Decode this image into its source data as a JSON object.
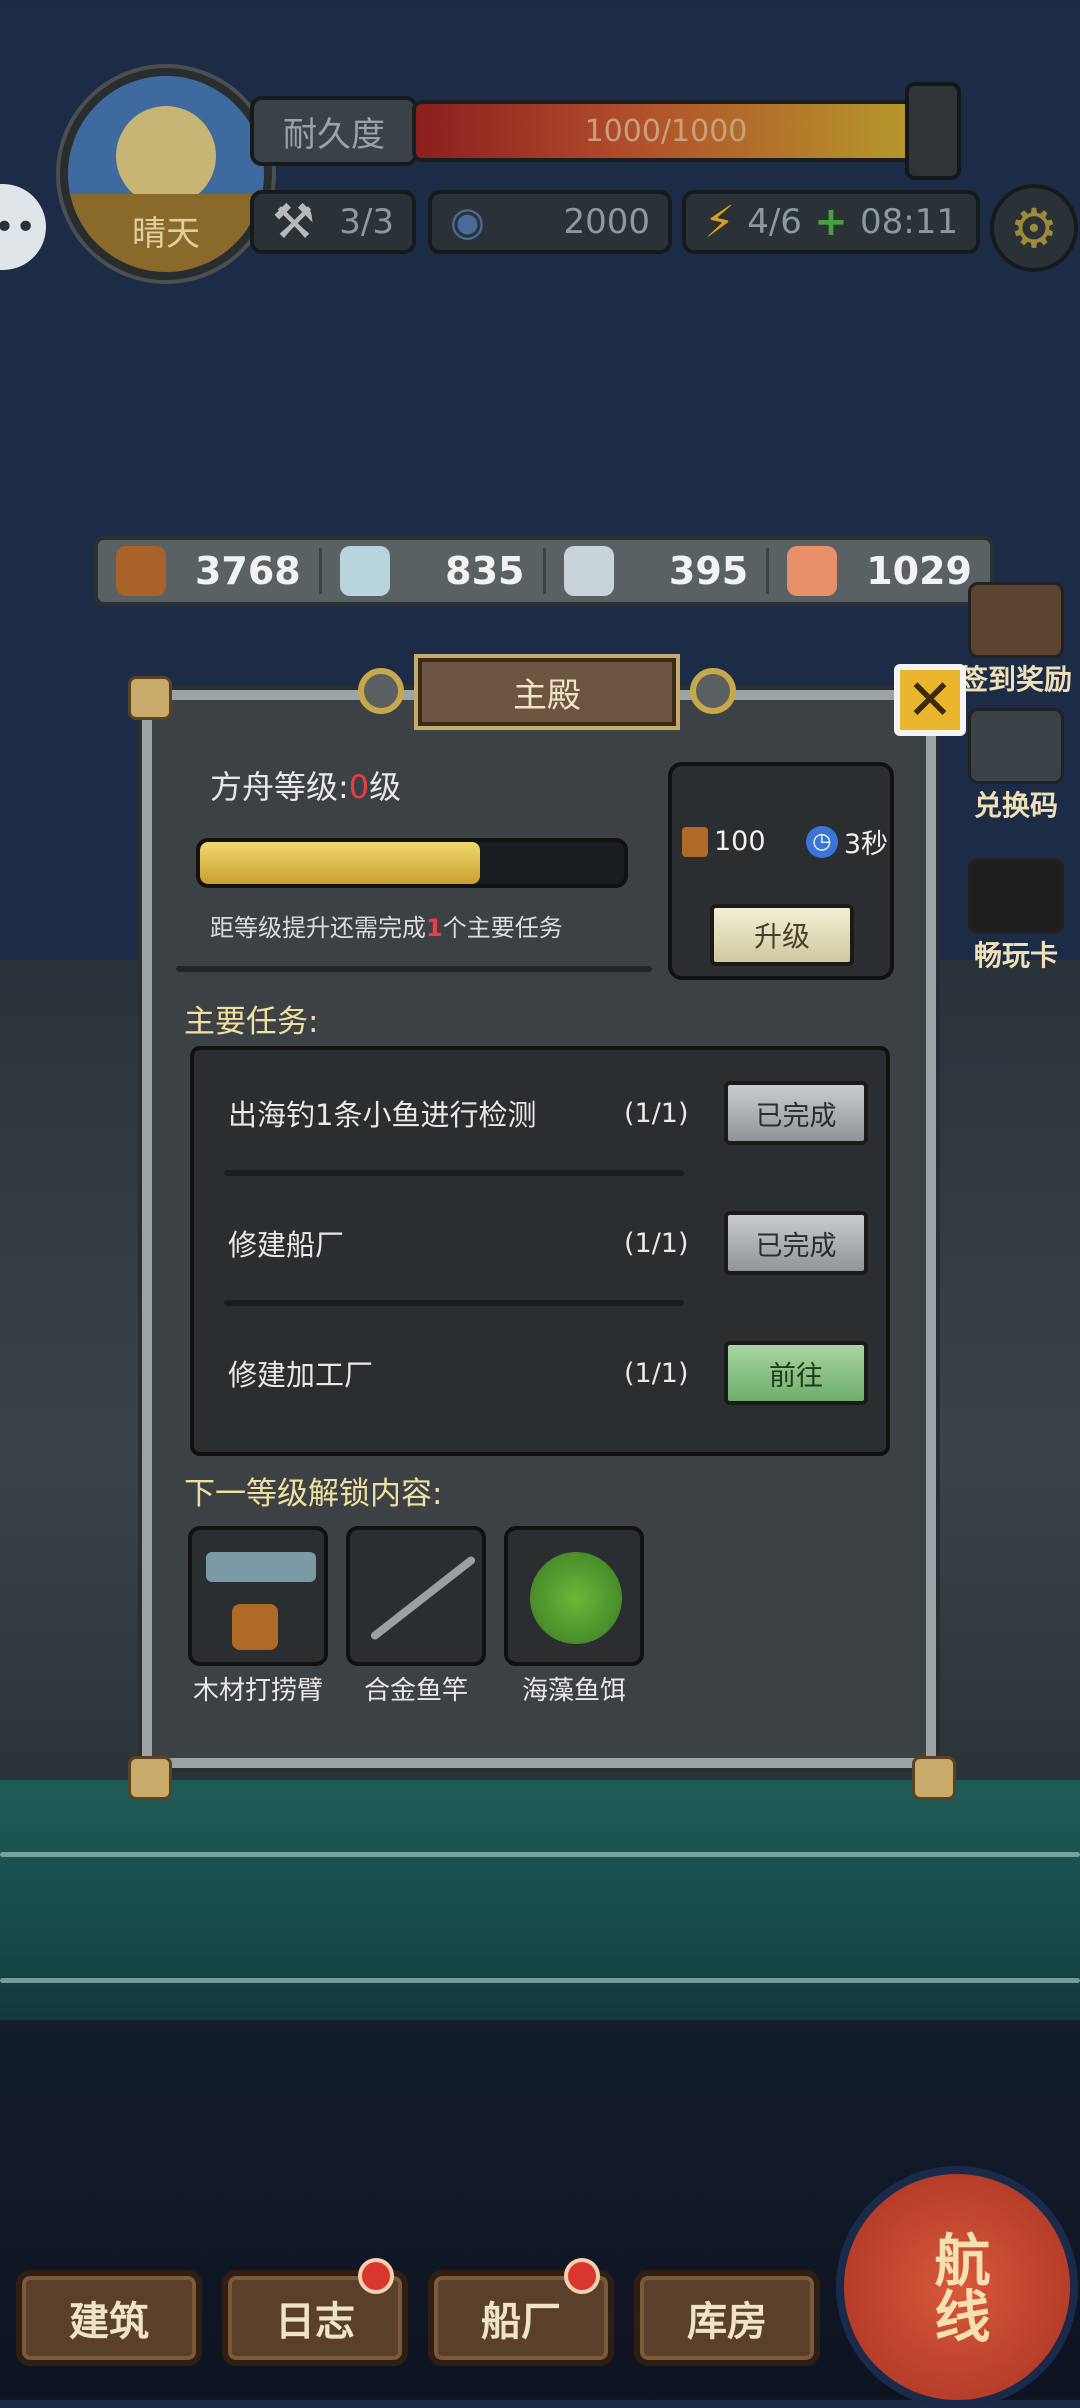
{
  "hud": {
    "weather": "晴天",
    "durability_label": "耐久度",
    "durability_value": "1000/1000",
    "tools": "3/3",
    "coins": "2000",
    "energy": "4/6",
    "energy_timer": "08:11"
  },
  "resources": [
    {
      "icon": "wood-log-icon",
      "value": "3768"
    },
    {
      "icon": "stone-stump-icon",
      "value": "835"
    },
    {
      "icon": "iron-ingot-icon",
      "value": "395"
    },
    {
      "icon": "fish-meat-icon",
      "value": "1029"
    }
  ],
  "side_menu": {
    "signin": "签到奖励",
    "redeem": "兑换码",
    "pass": "畅玩卡"
  },
  "dialog": {
    "title": "主殿",
    "level_label": "方舟等级:",
    "level_value": "0",
    "level_unit": "级",
    "progress_fraction": 0.66,
    "desc_prefix": "距等级提升还需完成",
    "desc_count": "1",
    "desc_suffix": "个主要任务",
    "cost_wood": "100",
    "cost_time": "3秒",
    "upgrade_label": "升级",
    "main_tasks_title": "主要任务:",
    "tasks": [
      {
        "name": "出海钓1条小鱼进行检测",
        "count": "(1/1)",
        "button": "已完成"
      },
      {
        "name": "修建船厂",
        "count": "(1/1)",
        "button": "已完成"
      },
      {
        "name": "修建加工厂",
        "count": "(1/1)",
        "button": "前往"
      }
    ],
    "unlock_title": "下一等级解锁内容:",
    "unlocks": [
      "木材打捞臂",
      "合金鱼竿",
      "海藻鱼饵"
    ]
  },
  "nav": {
    "build": "建筑",
    "log": "日志",
    "shipyard": "船厂",
    "storage": "库房",
    "route": "航线"
  },
  "colors": {
    "accent_gold": "#e9b62e",
    "alert_red": "#e84040",
    "go_green": "#6fae6a"
  }
}
